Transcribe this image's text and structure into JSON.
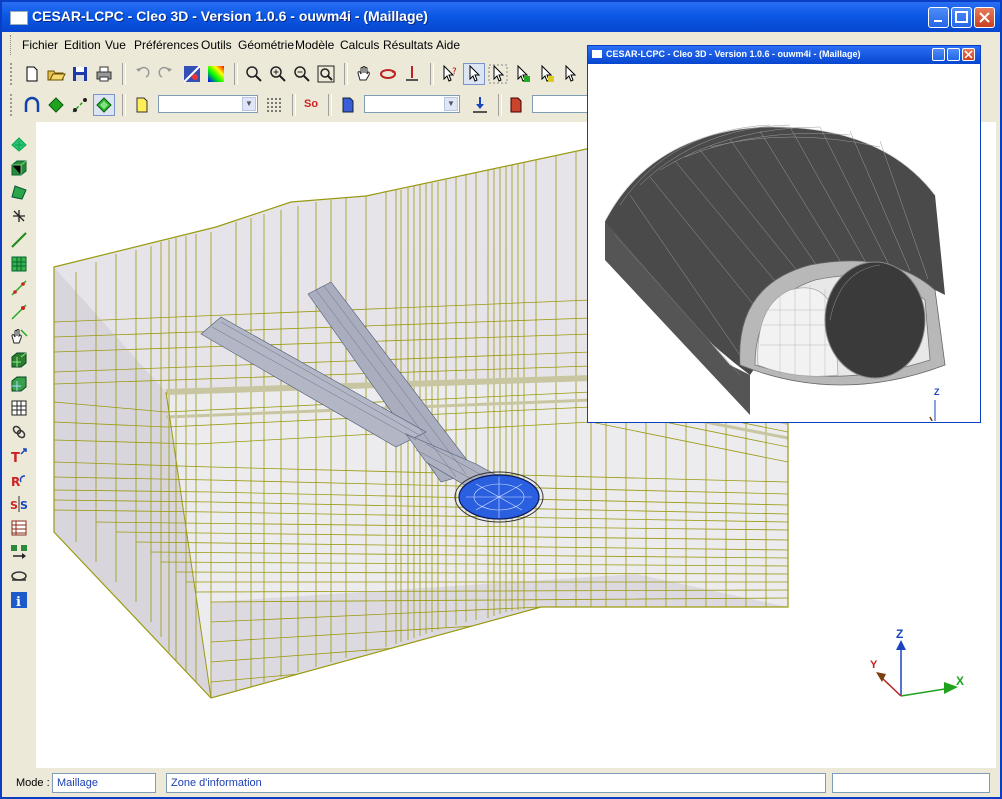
{
  "window": {
    "title": "CESAR-LCPC - Cleo 3D - Version 1.0.6 - ouwm4i - (Maillage)"
  },
  "menu": [
    "Fichier",
    "Edition",
    "Vue",
    "Préférences",
    "Outils",
    "Géométrie",
    "Modèle",
    "Calculs",
    "Résultats",
    "Aide"
  ],
  "toolbar2": {
    "so_label": "So"
  },
  "inset": {
    "title": "CESAR-LCPC - Cleo 3D - Version 1.0.6 - ouwm4i - (Maillage)"
  },
  "axes": {
    "x": "X",
    "y": "Y",
    "z": "Z"
  },
  "status": {
    "mode_label": "Mode :",
    "mode_value": "Maillage",
    "info_value": "Zone d'information"
  },
  "colors": {
    "titlebar": "#0b58e5",
    "mesh_lines": "#9a9a10",
    "tunnel_blue": "#1f5adc",
    "inset_dark": "#4a4a4a"
  }
}
